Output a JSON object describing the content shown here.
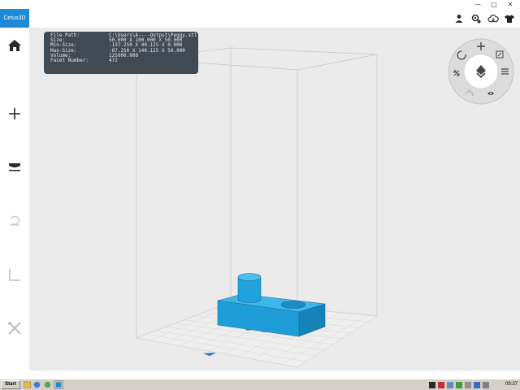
{
  "app": {
    "title": "Cetus3D"
  },
  "window_controls": {
    "minimize": "—",
    "maximize": "□",
    "close": "✕"
  },
  "toolbar": {
    "icons": [
      "user-icon",
      "settings-icon",
      "cloud-icon",
      "shirt-icon"
    ]
  },
  "sidebar": {
    "items": [
      {
        "name": "home",
        "icon": "home-icon"
      },
      {
        "name": "add",
        "icon": "plus-icon"
      },
      {
        "name": "layer",
        "icon": "layer-icon"
      },
      {
        "name": "rotate",
        "icon": "rotate-icon"
      },
      {
        "name": "support",
        "icon": "support-icon"
      },
      {
        "name": "tools",
        "icon": "tools-icon"
      }
    ]
  },
  "info_panel": {
    "rows": [
      {
        "label": "File Path:",
        "value": "C:\\Users\\A----Output\\Peggy.stl"
      },
      {
        "label": "Size:",
        "value": "50.000   X 100.000  X 50.000"
      },
      {
        "label": "Min-Size:",
        "value": "-137.250 X 40.125   X 0.000"
      },
      {
        "label": "Max-Size:",
        "value": "-87.250  X 140.125  X 50.000"
      },
      {
        "label": "Volume:",
        "value": "125000.008"
      },
      {
        "label": "Facet Number:",
        "value": "472"
      }
    ]
  },
  "taskbar": {
    "start_label": "Start",
    "clock": "09:37"
  },
  "colors": {
    "accent": "#1e8ad6",
    "model": "#2aa8e0",
    "panel": "#3f4a53",
    "viewport": "#ebebeb"
  }
}
